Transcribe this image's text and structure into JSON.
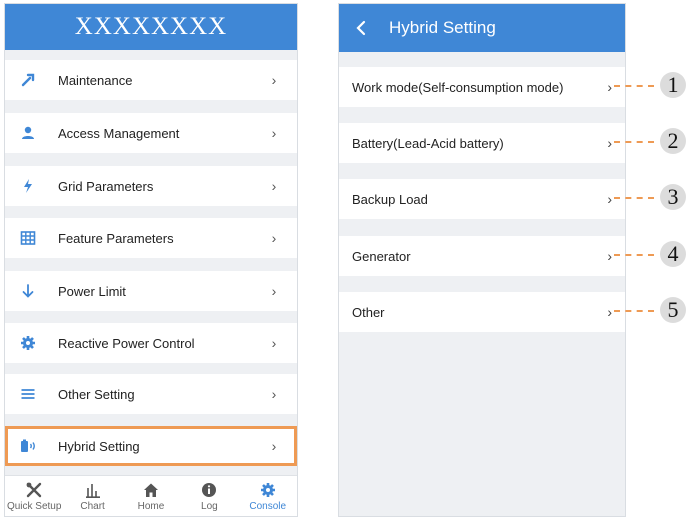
{
  "left_phone": {
    "header_title": "XXXXXXXX",
    "menu_items": [
      {
        "label": "Maintenance",
        "icon": "wrench-icon"
      },
      {
        "label": "Access Management",
        "icon": "user-icon"
      },
      {
        "label": "Grid Parameters",
        "icon": "lightning-icon"
      },
      {
        "label": "Feature Parameters",
        "icon": "grid-icon"
      },
      {
        "label": "Power Limit",
        "icon": "arrow-down-icon"
      },
      {
        "label": "Reactive Power Control",
        "icon": "gear-icon"
      },
      {
        "label": "Other Setting",
        "icon": "menu-lines-icon"
      },
      {
        "label": "Hybrid Setting",
        "icon": "battery-signal-icon",
        "highlighted": true
      }
    ],
    "tabs": [
      {
        "label": "Quick Setup",
        "icon": "tools-icon"
      },
      {
        "label": "Chart",
        "icon": "bar-chart-icon"
      },
      {
        "label": "Home",
        "icon": "home-icon"
      },
      {
        "label": "Log",
        "icon": "info-icon"
      },
      {
        "label": "Console",
        "icon": "gear-icon",
        "active": true
      }
    ]
  },
  "right_phone": {
    "header_title": "Hybrid Setting",
    "items": [
      {
        "label": "Work mode(Self-consumption mode)",
        "callout": "1"
      },
      {
        "label": "Battery(Lead-Acid battery)",
        "callout": "2"
      },
      {
        "label": "Backup Load",
        "callout": "3"
      },
      {
        "label": "Generator",
        "callout": "4"
      },
      {
        "label": "Other",
        "callout": "5"
      }
    ]
  },
  "colors": {
    "header_blue": "#3f87d6",
    "highlight_orange": "#ee9a54",
    "background_gray": "#eef0f3"
  }
}
